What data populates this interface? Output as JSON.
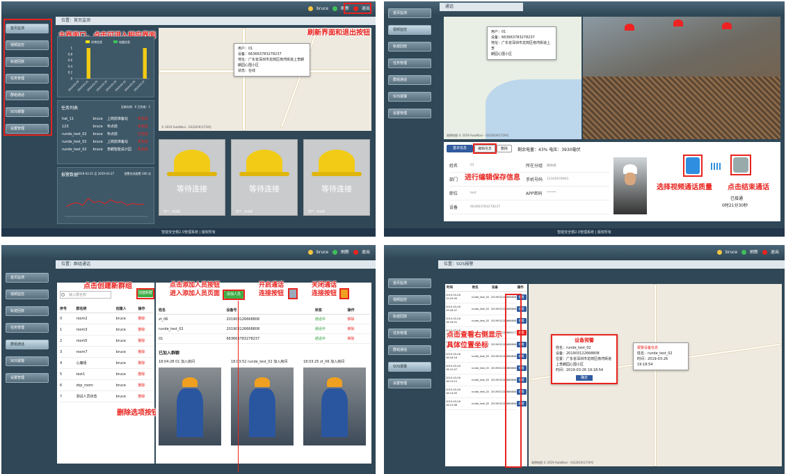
{
  "user": {
    "name": "bruce",
    "refresh": "刷新",
    "exit": "退出"
  },
  "footer": "智能安全帽2.0管理系统 | 版权所有",
  "colors": {
    "accent_red": "#e8231e",
    "sidebar": "#2f4756",
    "helmet_yellow": "#f2cb16"
  },
  "panel1": {
    "breadcrumb": "位置：首页监测",
    "menu": [
      "首页监测",
      "视频监控",
      "轨迹回放",
      "任务管理",
      "群组通话",
      "SOS报警",
      "设置管理"
    ],
    "ann_menu": "主界面口，点击可进入相应界面",
    "ann_refresh": "刷新界面和退出按钮",
    "legend": [
      "异常信息",
      "电量信息"
    ],
    "bar_chart": {
      "type": "bar",
      "yticks": [
        "1",
        "0.8",
        "0.6",
        "0.4",
        "0.2",
        "0"
      ],
      "categories": [
        "2019-03-20",
        "2019-03-21",
        "2019-03-22",
        "2019-03-23",
        "2019-03-24",
        "2019-03-25",
        "2019-03-26",
        "2019-03-27"
      ],
      "series": [
        {
          "name": "电量信息",
          "values": [
            0,
            1,
            0,
            0,
            0,
            0,
            0,
            1
          ]
        }
      ],
      "ylim": [
        0,
        1
      ]
    },
    "task_title": "任务列表",
    "task_meta": "当前在线：0 已完成：1",
    "tasks": [
      [
        "hat_11",
        "bruce",
        "上岗前准备站",
        "未完成"
      ],
      [
        "123",
        "bruce",
        "布点前",
        "未完成"
      ],
      [
        "runde_test_02",
        "bruce",
        "布点前",
        "已完成"
      ],
      [
        "runde_test_02",
        "bruce",
        "上岗前准备站",
        "未完成"
      ],
      [
        "runde_test_02",
        "bruce",
        "李朗智能设计园",
        "未完成"
      ]
    ],
    "alarm_title": "报警数据",
    "alarm_range": "2019-03-21 至 2019-03-27",
    "alarm_total": "报警台风报警 200 次",
    "map_popup": [
      "用户：01",
      "设备：663663783278237",
      "地址：广东省深圳市龙岗区南湾街道上李朗",
      "朗园心围小区",
      "状态：在线"
    ],
    "map_copy": "© 2019 AutoNavi - GS(2019)1719号",
    "helmets": [
      "等待连接",
      "等待连接",
      "等待连接"
    ],
    "helmet_user": "用户：未连接",
    "helmet_close": "关闭"
  },
  "panel2": {
    "menu": [
      "首页监测",
      "视频监控",
      "轨迹回放",
      "任务管理",
      "群组通话",
      "SOS报警",
      "设置管理"
    ],
    "breadcrumb": "通话",
    "popup": [
      "用户：01",
      "设备：663663783278237",
      "地址：广东省深圳市龙岗区南湾街道上李",
      "朗园心围小区"
    ],
    "map_copy": "高德地图 © 2019 AutoNavi - GS(2019)1719号",
    "tabs": [
      "基本信息",
      "编辑信息",
      "删除"
    ],
    "battery": "剩余电量：43%   电压：3930毫伏",
    "fields": [
      [
        "姓名",
        "01",
        "所在分组",
        "微体组"
      ],
      [
        "部门",
        "",
        "手机号码",
        "12345678901"
      ],
      [
        "职位",
        "test",
        "APP密码",
        "******"
      ],
      [
        "设备",
        "663663783278237",
        "",
        ""
      ]
    ],
    "ann_edit": "进行编辑保存信息",
    "ann_quality": "选择视频通话质量",
    "ann_end": "点击结束通话",
    "call_state": "已接通",
    "call_time": "0时21分30秒"
  },
  "panel3": {
    "breadcrumb": "位置：群组通话",
    "menu": [
      "首页监测",
      "视频监控",
      "轨迹回放",
      "任务管理",
      "群组通话",
      "SOS报警",
      "设置管理"
    ],
    "search_placeholder": "输入群名称",
    "create_btn": "创建新群",
    "ann_create": "点击创建新群组",
    "ann_add": "点击添加人员按钮\n进入添加人员页面",
    "ann_open": "开启通话\n连接按钮",
    "ann_close": "关闭通话\n连接按钮",
    "ann_delete": "删除选项按钮",
    "add_btn": "添加人员",
    "group_headers": [
      "序号",
      "群名称",
      "创建人",
      "操作"
    ],
    "groups": [
      [
        "0",
        "room2",
        "bruce",
        "删除"
      ],
      [
        "1",
        "room3",
        "bruce",
        "删除"
      ],
      [
        "2",
        "room5",
        "bruce",
        "删除"
      ],
      [
        "3",
        "room7",
        "bruce",
        "删除"
      ],
      [
        "4",
        "心魔组",
        "bruce",
        "删除"
      ],
      [
        "5",
        "test1",
        "bruce",
        "删除"
      ],
      [
        "6",
        "zbp_room",
        "bruce",
        "删除"
      ],
      [
        "7",
        "测试人员状态",
        "bruce",
        "删除"
      ]
    ],
    "member_headers": [
      "姓名",
      "设备号",
      "状态",
      "操作"
    ],
    "members": [
      [
        "zt_06",
        "201903126668806",
        "通话中",
        "移除"
      ],
      [
        "runde_test_02",
        "201903126668808",
        "通话中",
        "移除"
      ],
      [
        "01",
        "663663783278237",
        "通话中",
        "移除"
      ]
    ],
    "joined_title": "已加入群聊",
    "joined": [
      {
        "time": "18:04:28",
        "name": "01",
        "action": "加入房间"
      },
      {
        "time": "18:03:52",
        "name": "runde_test_02",
        "action": "加入房间"
      },
      {
        "time": "18:03:25",
        "name": "zt_06",
        "action": "加入房间"
      }
    ]
  },
  "panel4": {
    "breadcrumb": "位置：SOS报警",
    "menu": [
      "首页监测",
      "视频监控",
      "轨迹回放",
      "任务管理",
      "群组通话",
      "SOS报警",
      "设置管理"
    ],
    "headers": [
      "时间",
      "姓名",
      "设备",
      "操作"
    ],
    "rows": [
      [
        "2019-03-26 19:29:09",
        "runde_test_02",
        "2019031226668808",
        "查看"
      ],
      [
        "2019-03-26 19:28:07",
        "runde_test_02",
        "2019031226668808",
        "查看"
      ],
      [
        "2019-03-26 18:16:51",
        "runde_test_02",
        "2019031226668808",
        "查看"
      ],
      [
        "2019-03-26 18:50:00",
        "01",
        "2019031226668217",
        "查看"
      ],
      [
        "2019-03-26 18:17:27",
        "runde_test_02",
        "2019031226668808",
        "查看"
      ],
      [
        "2019-03-26 18:16:18",
        "runde_test_02",
        "2019031226668808",
        "查看"
      ],
      [
        "2019-03-26 18:15:57",
        "runde_test_02",
        "2019031226668808",
        "查看"
      ],
      [
        "2019-03-26 18:15:12",
        "runde_test_02",
        "2019031226668808",
        "查看"
      ],
      [
        "2019-03-26 18:14:05",
        "runde_test_02",
        "2019031226668808",
        "查看"
      ],
      [
        "2019-03-26 18:13:48",
        "runde_test_02",
        "2019031226668808",
        "查看"
      ]
    ],
    "ann_view": "点击查看右侧显示\n具体位置坐标",
    "alarm_title": "设备预警",
    "alarm_name": "姓名：runde_test_02",
    "alarm_device": "设备：201903122668808",
    "alarm_pos": "位置：广东省深圳市龙岗区南湾街道上李朗园心围小区",
    "alarm_time": "时间：2019-03-26 19:18:54",
    "alarm_ok": "确定",
    "map_popup": [
      "报警设备信息",
      "姓名：runde_test_02",
      "时间：2019-03-26 19:18:54"
    ],
    "map_copy": "高德地图 © 2019 AutoNavi - GS(2019)1719号"
  }
}
